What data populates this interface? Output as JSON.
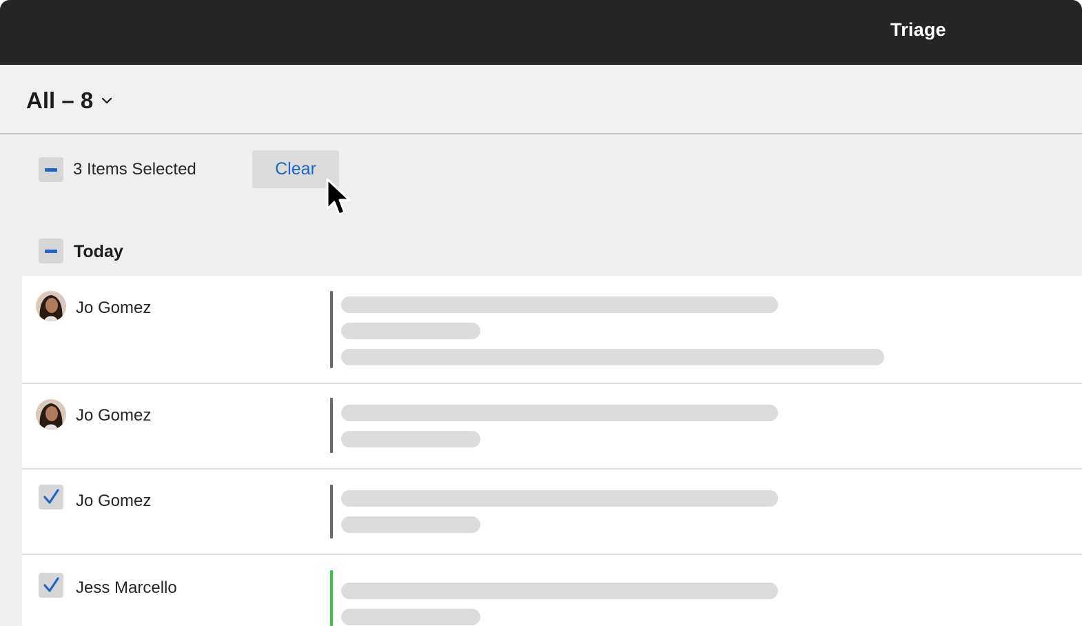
{
  "header": {
    "title": "Triage"
  },
  "filter": {
    "label": "All – 8"
  },
  "selection": {
    "count_label": "3 Items Selected",
    "clear_label": "Clear"
  },
  "group": {
    "label": "Today"
  },
  "messages": [
    {
      "sender": "Jo Gomez",
      "selected": false,
      "status_color": "#6b6b6b",
      "skeleton_lines": 3
    },
    {
      "sender": "Jo Gomez",
      "selected": false,
      "status_color": "#6b6b6b",
      "skeleton_lines": 2
    },
    {
      "sender": "Jo Gomez",
      "selected": true,
      "status_color": "#6b6b6b",
      "skeleton_lines": 2
    },
    {
      "sender": "Jess Marcello",
      "selected": true,
      "status_color": "#3cc23c",
      "skeleton_lines": 2
    }
  ],
  "colors": {
    "topbar": "#252525",
    "accent": "#1f66c9",
    "background": "#efefef",
    "skeleton": "#dcdcdc"
  }
}
